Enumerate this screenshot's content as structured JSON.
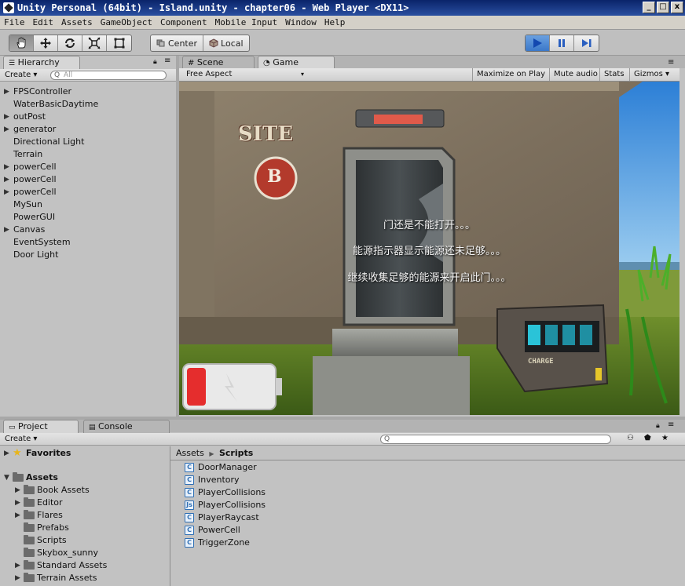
{
  "window": {
    "title": "Unity Personal (64bit) - Island.unity - chapter06 - Web Player <DX11>",
    "minimize_label": "_",
    "maximize_label": "□",
    "close_label": "x"
  },
  "menu": [
    "File",
    "Edit",
    "Assets",
    "GameObject",
    "Component",
    "Mobile Input",
    "Window",
    "Help"
  ],
  "toolbar": {
    "transform_tools": [
      "hand-icon",
      "move-icon",
      "rotate-icon",
      "scale-icon",
      "rect-icon"
    ],
    "pivot_label": "Center",
    "space_label": "Local",
    "play_icons": [
      "play-icon",
      "pause-icon",
      "step-icon"
    ]
  },
  "hierarchy": {
    "tab_label": "Hierarchy",
    "create_label": "Create",
    "search_placeholder": "All",
    "items": [
      {
        "label": "FPSController",
        "expandable": true
      },
      {
        "label": "WaterBasicDaytime",
        "expandable": false
      },
      {
        "label": "outPost",
        "expandable": true
      },
      {
        "label": "generator",
        "expandable": true
      },
      {
        "label": "Directional Light",
        "expandable": false
      },
      {
        "label": "Terrain",
        "expandable": false
      },
      {
        "label": "powerCell",
        "expandable": true
      },
      {
        "label": "powerCell",
        "expandable": true
      },
      {
        "label": "powerCell",
        "expandable": true
      },
      {
        "label": "MySun",
        "expandable": false
      },
      {
        "label": "PowerGUI",
        "expandable": false
      },
      {
        "label": "Canvas",
        "expandable": true
      },
      {
        "label": "EventSystem",
        "expandable": false
      },
      {
        "label": "Door Light",
        "expandable": false
      }
    ]
  },
  "game_view": {
    "scene_tab": "Scene",
    "game_tab": "Game",
    "aspect": "Free Aspect",
    "maximize_on_play": "Maximize on Play",
    "mute_audio": "Mute audio",
    "stats": "Stats",
    "gizmos": "Gizmos",
    "sign_text": "SITE",
    "sign_letter": "B",
    "charge_label": "CHARGE",
    "subtitles": [
      "门还是不能打开。。。",
      "能源指示器显示能源还未足够。。。",
      "继续收集足够的能源来开启此门。。。"
    ],
    "battery_level": 0.2
  },
  "project": {
    "tab_label": "Project",
    "console_tab": "Console",
    "create_label": "Create",
    "favorites_label": "Favorites",
    "assets_label": "Assets",
    "folders": [
      {
        "label": "Book Assets",
        "expandable": true
      },
      {
        "label": "Editor",
        "expandable": true
      },
      {
        "label": "Flares",
        "expandable": true
      },
      {
        "label": "Prefabs",
        "expandable": false
      },
      {
        "label": "Scripts",
        "expandable": false
      },
      {
        "label": "Skybox_sunny",
        "expandable": false
      },
      {
        "label": "Standard Assets",
        "expandable": true
      },
      {
        "label": "Terrain Assets",
        "expandable": true
      }
    ],
    "breadcrumb": [
      "Assets",
      "Scripts"
    ],
    "files": [
      {
        "label": "DoorManager",
        "type": "C#"
      },
      {
        "label": "Inventory",
        "type": "C#"
      },
      {
        "label": "PlayerCollisions",
        "type": "C#"
      },
      {
        "label": "PlayerCollisions",
        "type": "JS"
      },
      {
        "label": "PlayerRaycast",
        "type": "C#"
      },
      {
        "label": "PowerCell",
        "type": "C#"
      },
      {
        "label": "TriggerZone",
        "type": "C#"
      }
    ]
  }
}
